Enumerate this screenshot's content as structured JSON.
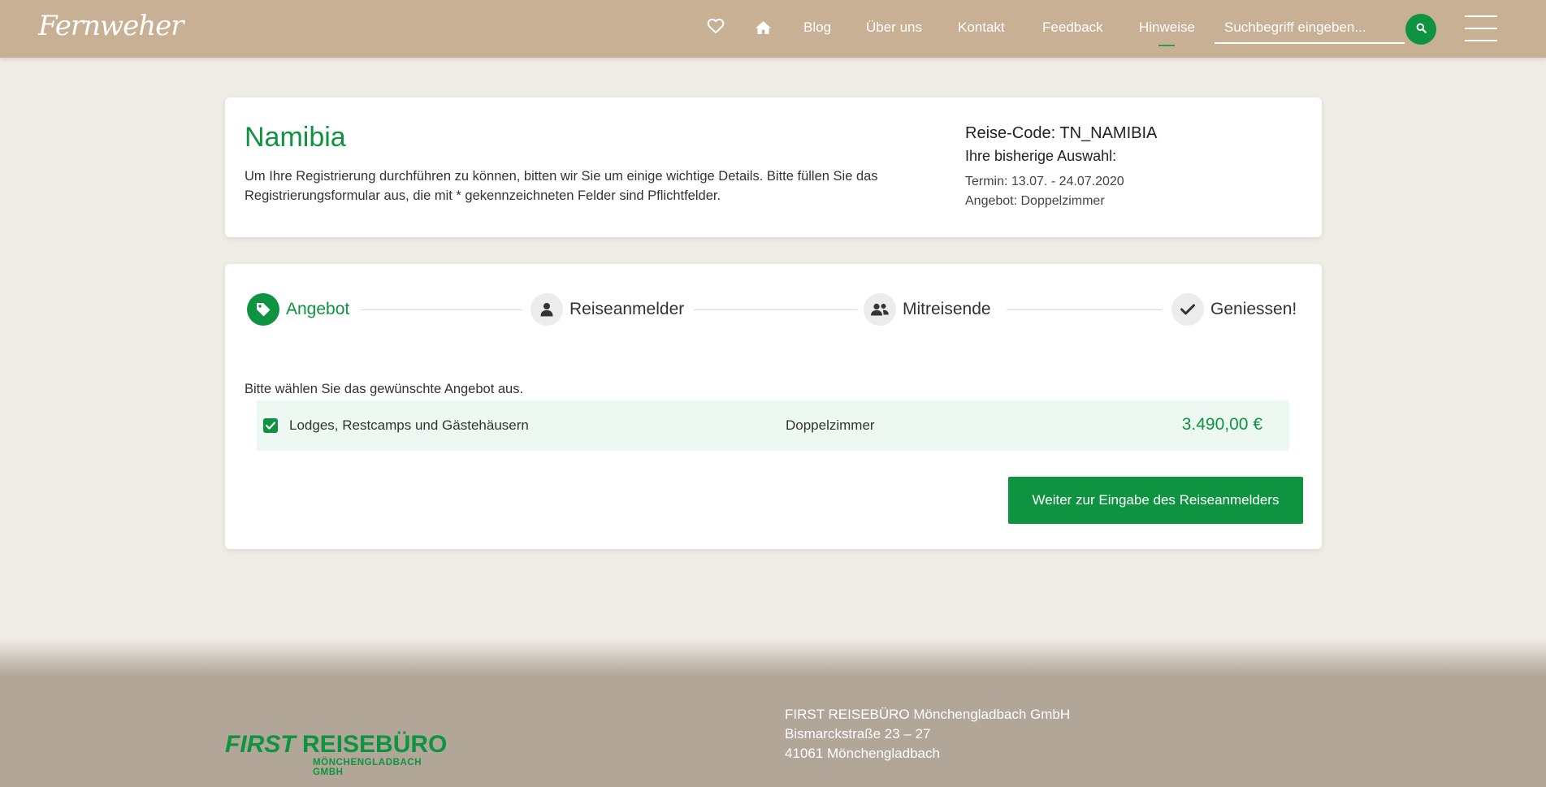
{
  "header": {
    "logo": "Fernweher",
    "nav": {
      "favorites_icon": "heart-icon",
      "home_icon": "home-icon",
      "items": [
        {
          "label": "Blog"
        },
        {
          "label": "Über uns"
        },
        {
          "label": "Kontakt"
        },
        {
          "label": "Feedback"
        },
        {
          "label": "Hinweise",
          "active": true
        }
      ]
    },
    "search": {
      "placeholder": "Suchbegriff eingeben...",
      "value": "",
      "icon": "search-icon"
    },
    "menu_icon": "hamburger-menu-icon"
  },
  "trip": {
    "title": "Namibia",
    "intro": "Um Ihre Registrierung durchführen zu können, bitten wir Sie um einige wichtige Details. Bitte füllen Sie das Registrierungsformular aus, die mit * gekennzeichneten Felder sind Pflichtfelder.",
    "code": "Reise-Code: TN_NAMIBIA",
    "selection_label": "Ihre bisherige Auswahl:",
    "date": "Termin: 13.07. - 24.07.2020",
    "offer": "Angebot: Doppelzimmer"
  },
  "steps": [
    {
      "label": "Angebot",
      "icon": "tag-icon",
      "active": true
    },
    {
      "label": "Reiseanmelder",
      "icon": "user-icon",
      "active": false
    },
    {
      "label": "Mitreisende",
      "icon": "users-icon",
      "active": false
    },
    {
      "label": "Geniessen!",
      "icon": "check-icon",
      "active": false
    }
  ],
  "offer_section": {
    "prompt": "Bitte wählen Sie das gewünschte Angebot aus.",
    "offers": [
      {
        "name": "Lodges, Restcamps und Gästehäusern",
        "room": "Doppelzimmer",
        "price": "3.490,00 €",
        "checked": true
      }
    ],
    "continue_label": "Weiter zur Eingabe des Reiseanmelders"
  },
  "footer": {
    "logo_main_first": "FIRST",
    "logo_main_second": "REISEBÜRO",
    "logo_sub": "MÖNCHENGLADBACH GMBH",
    "address": [
      "FIRST REISEBÜRO Mönchengladbach GmbH",
      "Bismarckstraße 23 – 27",
      "41061 Mönchengladbach"
    ]
  },
  "colors": {
    "header_bg": "#c7b094",
    "page_bg": "#f0ede6",
    "accent_green": "#0e9440",
    "offer_row_bg": "#eef8f2",
    "footer_bg": "#b1a698"
  }
}
